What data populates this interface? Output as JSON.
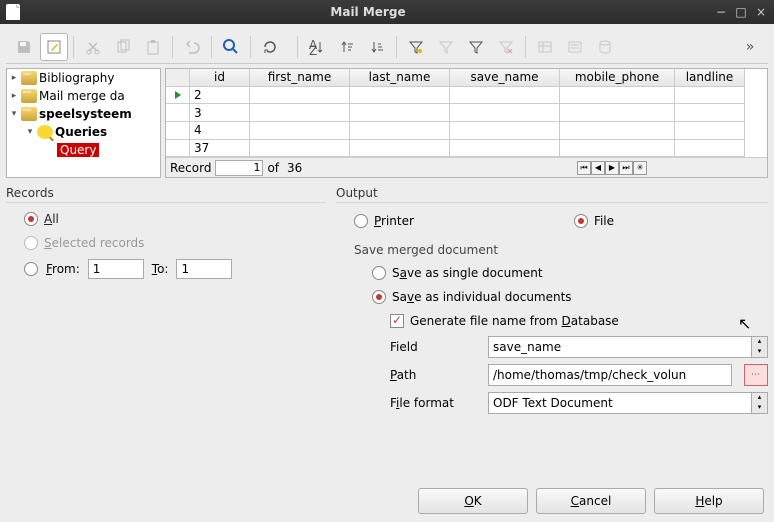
{
  "window": {
    "title": "Mail Merge"
  },
  "tree": {
    "items": [
      {
        "label": "Bibliography",
        "bold": false,
        "icon": "db"
      },
      {
        "label": "Mail merge da",
        "bold": false,
        "icon": "db"
      },
      {
        "label": "speelsysteem",
        "bold": true,
        "icon": "db"
      },
      {
        "label": "Queries",
        "bold": true,
        "icon": "q"
      },
      {
        "label": "Query",
        "selected": true,
        "icon": "none"
      }
    ]
  },
  "grid": {
    "headers": [
      "id",
      "first_name",
      "last_name",
      "save_name",
      "mobile_phone",
      "landline"
    ],
    "rows": [
      {
        "id": "2",
        "playing": true
      },
      {
        "id": "3"
      },
      {
        "id": "4"
      },
      {
        "id": "37"
      }
    ],
    "nav": {
      "label": "Record",
      "current": "1",
      "of_label": "of",
      "total": "36"
    }
  },
  "records": {
    "title": "Records",
    "all": "All",
    "selected": "Selected records",
    "from_label": "From:",
    "from_value": "1",
    "to_label": "To:",
    "to_value": "1"
  },
  "output": {
    "title": "Output",
    "printer": "Printer",
    "file": "File",
    "save_title": "Save merged document",
    "save_single": "Save as single document",
    "save_individual": "Save as individual documents",
    "gen_filename": "Generate file name from Database",
    "field_label": "Field",
    "field_value": "save_name",
    "path_label": "Path",
    "path_value": "/home/thomas/tmp/check_volun",
    "format_label": "File format",
    "format_value": "ODF Text Document"
  },
  "buttons": {
    "ok": "OK",
    "cancel": "Cancel",
    "help": "Help"
  }
}
